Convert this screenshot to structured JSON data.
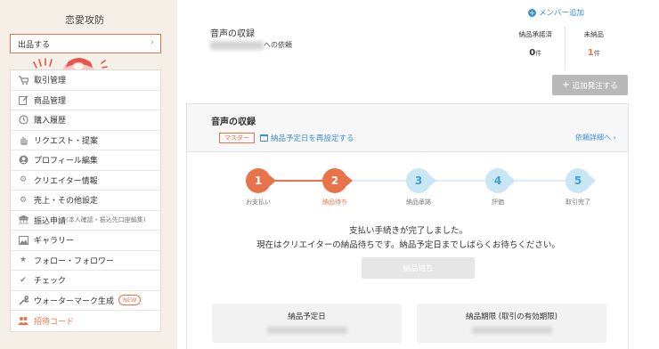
{
  "sidebar": {
    "shop_name": "恋愛攻防",
    "sell_button": "出品する",
    "menu": [
      {
        "label": "取引管理",
        "icon": "cart-icon"
      },
      {
        "label": "商品管理",
        "icon": "edit-icon"
      },
      {
        "label": "購入履歴",
        "icon": "history-icon"
      },
      {
        "label": "リクエスト・提案",
        "icon": "hand-icon"
      },
      {
        "label": "プロフィール編集",
        "icon": "profile-icon"
      },
      {
        "label": "クリエイター情報",
        "icon": "gear-icon"
      },
      {
        "label": "売上・その他設定",
        "icon": "settings-icon"
      },
      {
        "label": "振込申請",
        "sub": "(本人確認・振込先口座編集)",
        "icon": "bank-icon"
      },
      {
        "label": "ギャラリー",
        "icon": "image-icon"
      },
      {
        "label": "フォロー・フォロワー",
        "icon": "star-icon"
      },
      {
        "label": "チェック",
        "icon": "check-icon"
      },
      {
        "label": "ウォーターマーク生成",
        "badge": "NEW",
        "icon": "wrench-icon"
      },
      {
        "label": "招待コード",
        "icon": "people-icon"
      }
    ]
  },
  "header": {
    "member_add": "メンバー追加",
    "request_title": "音声の収録",
    "request_suffix": "への依頼",
    "stats": [
      {
        "label": "納品承諾済",
        "value": "0",
        "unit": "件"
      },
      {
        "label": "未納品",
        "value": "1",
        "unit": "件"
      }
    ],
    "add_order_button": "追加発注する"
  },
  "card": {
    "title": "音声の収録",
    "master_tag": "マスター",
    "reset_link": "納品予定日を再設定する",
    "detail_link": "依頼詳細へ ›",
    "steps": [
      {
        "num": "1",
        "label": "お支払い",
        "state": "done"
      },
      {
        "num": "2",
        "label": "納品待ち",
        "state": "current"
      },
      {
        "num": "3",
        "label": "納品承諾",
        "state": "pending"
      },
      {
        "num": "4",
        "label": "評価",
        "state": "pending"
      },
      {
        "num": "5",
        "label": "取引完了",
        "state": "pending"
      }
    ],
    "message_line1": "支払い手続きが完了しました。",
    "message_line2": "現在はクリエイターの納品待ちです。納品予定日までしばらくお待ちください。",
    "wait_button": "納品待ち",
    "delivery_date_label": "納品予定日",
    "deadline_label": "納品期限 (取引の有効期限)"
  },
  "colors": {
    "accent": "#e8734a",
    "link": "#3d8fd1",
    "step_pending": "#c8e6f4"
  }
}
